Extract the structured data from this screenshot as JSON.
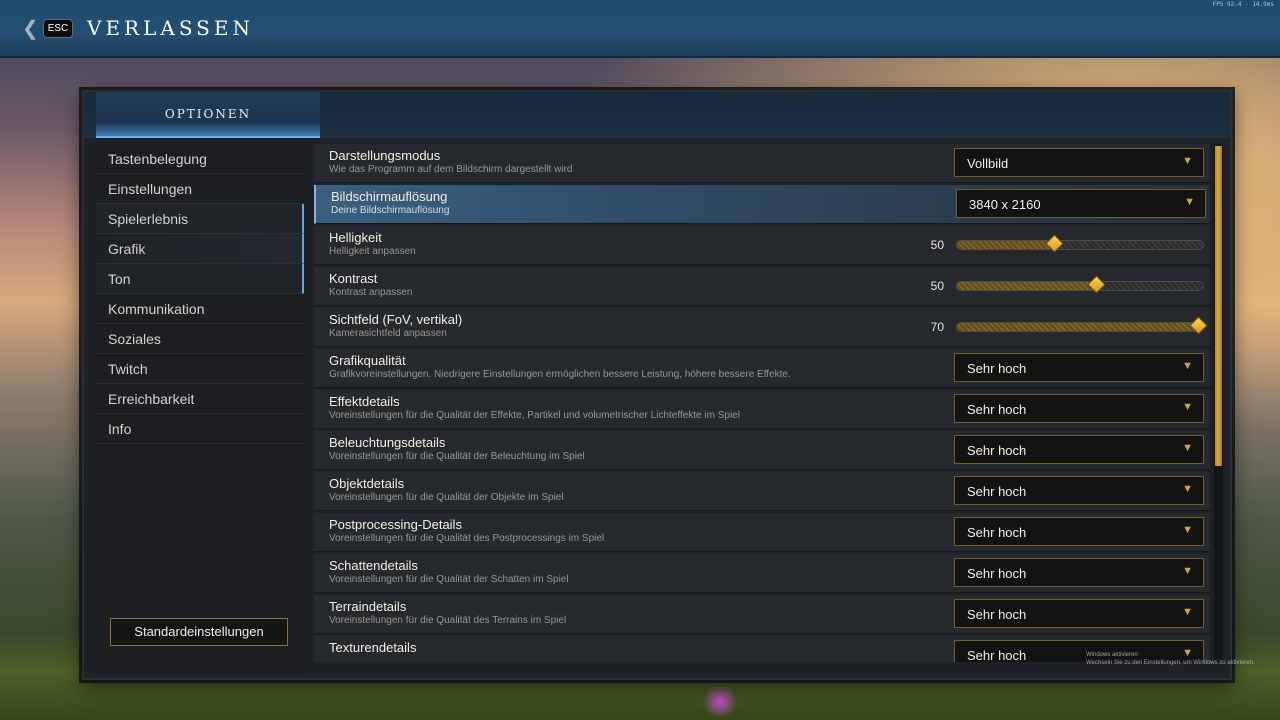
{
  "topbar": {
    "back_icon": "chevron-left-icon",
    "esc_label": "ESC",
    "title": "VERLASSEN",
    "fps_text": "FPS 92.4 · 14.9ms"
  },
  "panel": {
    "tab_label": "OPTIONEN"
  },
  "sidebar": {
    "items": [
      {
        "label": "Tastenbelegung"
      },
      {
        "label": "Einstellungen"
      },
      {
        "label": "Spielerlebnis"
      },
      {
        "label": "Grafik"
      },
      {
        "label": "Ton"
      },
      {
        "label": "Kommunikation"
      },
      {
        "label": "Soziales"
      },
      {
        "label": "Twitch"
      },
      {
        "label": "Erreichbarkeit"
      },
      {
        "label": "Info"
      }
    ],
    "defaults_button": "Standardeinstellungen"
  },
  "settings": [
    {
      "title": "Darstellungsmodus",
      "desc": "Wie das Programm auf dem Bildschirm dargestellt wird",
      "value": "Vollbild"
    },
    {
      "title": "Bildschirmauflösung",
      "desc": "Deine Bildschirmauflösung",
      "value": "3840 x 2160"
    },
    {
      "title": "Helligkeit",
      "desc": "Helligkeit anpassen",
      "slider_value": "50",
      "slider_fraction": 0.4
    },
    {
      "title": "Kontrast",
      "desc": "Kontrast anpassen",
      "slider_value": "50",
      "slider_fraction": 0.57
    },
    {
      "title": "Sichtfeld (FoV, vertikal)",
      "desc": "Kamerasichtfeld anpassen",
      "slider_value": "70",
      "slider_fraction": 0.98
    },
    {
      "title": "Grafikqualität",
      "desc": "Grafikvoreinstellungen. Niedrigere Einstellungen ermöglichen bessere Leistung, höhere bessere Effekte.",
      "value": "Sehr hoch"
    },
    {
      "title": "Effektdetails",
      "desc": "Voreinstellungen für die Qualität der Effekte, Partikel und volumetrischer Lichteffekte im Spiel",
      "value": "Sehr hoch"
    },
    {
      "title": "Beleuchtungsdetails",
      "desc": "Voreinstellungen für die Qualität der Beleuchtung im Spiel",
      "value": "Sehr hoch"
    },
    {
      "title": "Objektdetails",
      "desc": "Voreinstellungen für die Qualität der Objekte im Spiel",
      "value": "Sehr hoch"
    },
    {
      "title": "Postprocessing-Details",
      "desc": "Voreinstellungen für die Qualität des Postprocessings im Spiel",
      "value": "Sehr hoch"
    },
    {
      "title": "Schattendetails",
      "desc": "Voreinstellungen für die Qualität der Schatten im Spiel",
      "value": "Sehr hoch"
    },
    {
      "title": "Terraindetails",
      "desc": "Voreinstellungen für die Qualität des Terrains im Spiel",
      "value": "Sehr hoch"
    },
    {
      "title": "Texturendetails",
      "desc": "",
      "value": "Sehr hoch"
    }
  ],
  "watermark": {
    "line1": "Windows aktivieren",
    "line2": "Wechseln Sie zu den Einstellungen, um Windows zu aktivieren."
  },
  "colors": {
    "accent_gold": "#c9a64a",
    "accent_blue": "#6aa3cf",
    "topbar_blue": "#234f73"
  }
}
